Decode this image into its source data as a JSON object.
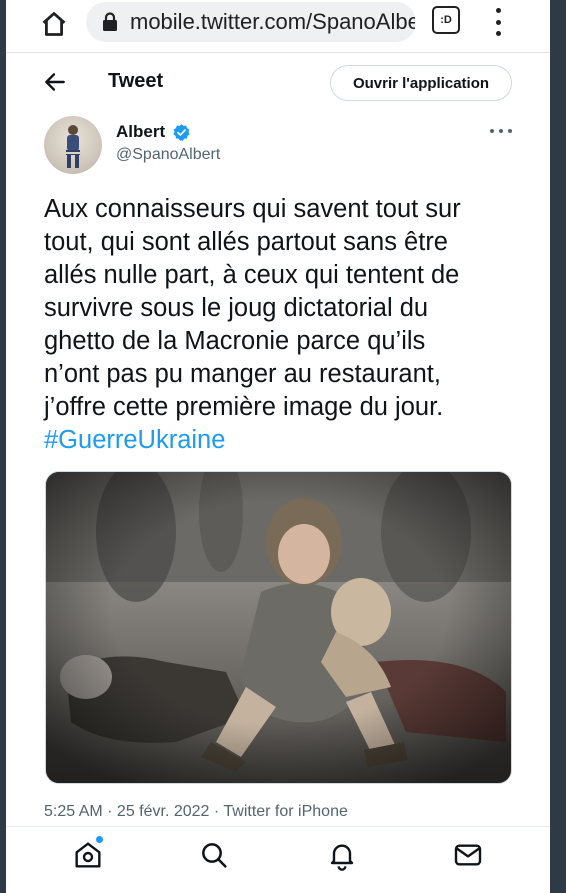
{
  "browser": {
    "url": "mobile.twitter.com/SpanoAlbert",
    "tab_count": ":D"
  },
  "header": {
    "title": "Tweet",
    "open_app_label": "Ouvrir l'application"
  },
  "tweet": {
    "author_name": "Albert",
    "author_handle": "@SpanoAlbert",
    "text_lines": [
      "Aux connaisseurs qui savent tout sur",
      "tout, qui sont allés partout sans être",
      "allés nulle part, à ceux qui tentent de",
      "survivre sous le joug dictatorial du",
      "ghetto de la Macronie parce qu’ils",
      "n’ont pas pu manger au restaurant,",
      "j’offre cette première image du jour."
    ],
    "hashtag": "#GuerreUkraine",
    "meta": "5:25 AM · 25 févr. 2022 · Twitter for iPhone"
  },
  "colors": {
    "accent": "#1d9bf0",
    "text": "#0f1419",
    "secondary": "#536471"
  },
  "icons": {
    "home": "home-icon",
    "lock": "lock-icon",
    "back": "arrow-left-icon",
    "verified": "verified-badge-icon",
    "more": "more-horizontal-icon",
    "nav": [
      "home-icon",
      "search-icon",
      "bell-icon",
      "mail-icon"
    ]
  }
}
